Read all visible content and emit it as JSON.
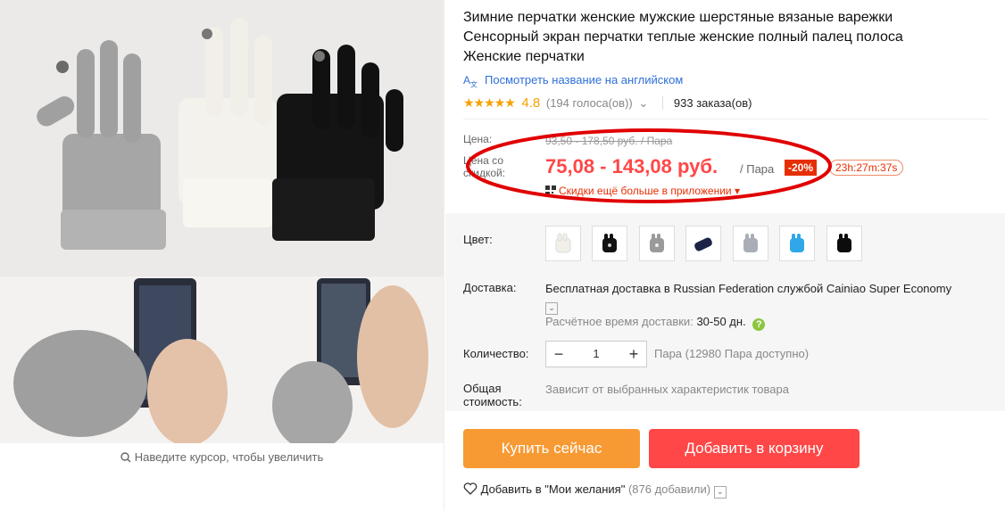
{
  "product": {
    "title": "Зимние перчатки женские мужские шерстяные вязаные варежки Сенсорный экран перчатки теплые женские полный палец полоса Женские перчатки",
    "translate_link": "Посмотреть название на английском",
    "translate_icon": "translate-icon",
    "stars": "★★★★★",
    "rating": "4.8",
    "votes": "(194 голоса(ов))",
    "orders": "933 заказа(ов)"
  },
  "gallery": {
    "zoom_hint": "Наведите курсор, чтобы увеличить"
  },
  "price": {
    "old_label": "Цена:",
    "old_value": "93,50 - 178,50 руб. / Пара",
    "new_label": "Цена со скидкой:",
    "new_value": "75,08 - 143,08 руб.",
    "unit": "/ Пара",
    "discount": "-20%",
    "timer": "23h:27m:37s",
    "app_promo": "Скидки ещё больше в приложении"
  },
  "sku": {
    "color_label": "Цвет:",
    "colors": [
      "#f2efe9",
      "#111111",
      "#9a9a9a",
      "#1d2346",
      "#a9aeb6",
      "#2fa7e8",
      "#0c0c0c"
    ],
    "shipping_label": "Доставка:",
    "shipping_text": "Бесплатная доставка в Russian Federation службой Cainiao Super Economy",
    "shipping_time_label": "Расчётное время доставки:",
    "shipping_time": "30-50 дн.",
    "qty_label": "Количество:",
    "qty_value": "1",
    "qty_minus": "−",
    "qty_plus": "+",
    "available": "Пара (12980 Пара доступно)",
    "total_label": "Общая стоимость:",
    "total_value": "Зависит от выбранных характеристик товара"
  },
  "actions": {
    "buy_now": "Купить сейчас",
    "add_to_cart": "Добавить в корзину",
    "wishlist": "Добавить в \"Мои желания\"",
    "wishlist_count": "(876 добавили)"
  },
  "colors": {
    "accent_red": "#ff4747",
    "orange": "#f79a34",
    "annotation_red": "#e00000"
  }
}
